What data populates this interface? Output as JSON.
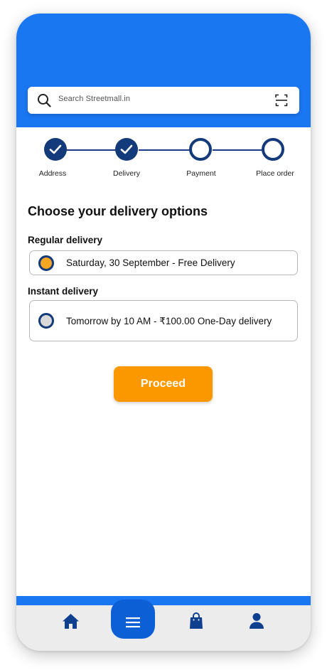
{
  "search": {
    "placeholder": "Search Streetmall.in"
  },
  "steps": [
    {
      "label": "Address",
      "status": "done"
    },
    {
      "label": "Delivery",
      "status": "done"
    },
    {
      "label": "Payment",
      "status": "pending"
    },
    {
      "label": "Place order",
      "status": "pending"
    }
  ],
  "page_title": "Choose your delivery options",
  "options": {
    "regular": {
      "heading": "Regular delivery",
      "text": "Saturday, 30 September - Free Delivery",
      "selected": true
    },
    "instant": {
      "heading": "Instant delivery",
      "text": "Tomorrow by 10 AM - ₹100.00 One-Day delivery",
      "selected": false
    }
  },
  "proceed_label": "Proceed",
  "nav": {
    "items": [
      "home-icon",
      "menu-icon",
      "bag-icon",
      "profile-icon"
    ],
    "active": "menu-icon"
  },
  "colors": {
    "brand_blue": "#1a77f2",
    "navy": "#133a7a",
    "accent_orange": "#fb9800",
    "selected_fill": "#f6a623",
    "unselected_fill": "#d9d9d9"
  }
}
